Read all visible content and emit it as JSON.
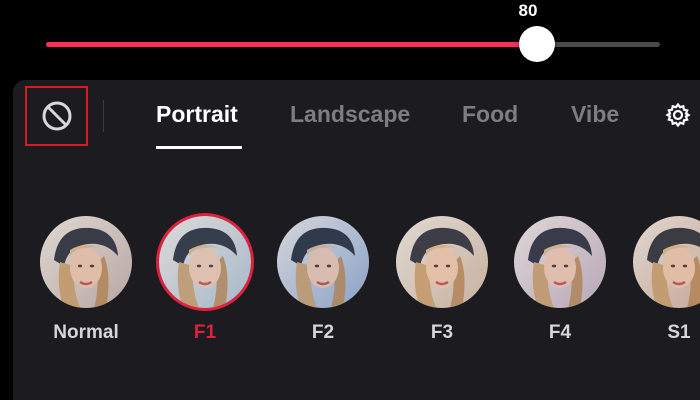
{
  "slider": {
    "value_label": "80",
    "value_fraction": 0.8
  },
  "toolbar": {
    "no_filter_icon": "no-filter-icon",
    "settings_icon": "gear-icon"
  },
  "tabs": [
    {
      "label": "Portrait",
      "active": true
    },
    {
      "label": "Landscape",
      "active": false
    },
    {
      "label": "Food",
      "active": false
    },
    {
      "label": "Vibe",
      "active": false
    }
  ],
  "filters": [
    {
      "label": "Normal",
      "selected": false,
      "tint": "#b9a7a3"
    },
    {
      "label": "F1",
      "selected": true,
      "tint": "#a7b9c9"
    },
    {
      "label": "F2",
      "selected": false,
      "tint": "#8aa2c9"
    },
    {
      "label": "F3",
      "selected": false,
      "tint": "#c6b2a0"
    },
    {
      "label": "F4",
      "selected": false,
      "tint": "#b8a8b8"
    },
    {
      "label": "S1",
      "selected": false,
      "tint": "#c2a595"
    }
  ],
  "colors": {
    "accent": "#ff2d55",
    "selected_label": "#e0203f",
    "panel_bg": "#1c1b1f",
    "highlight_box": "#d81b22"
  }
}
